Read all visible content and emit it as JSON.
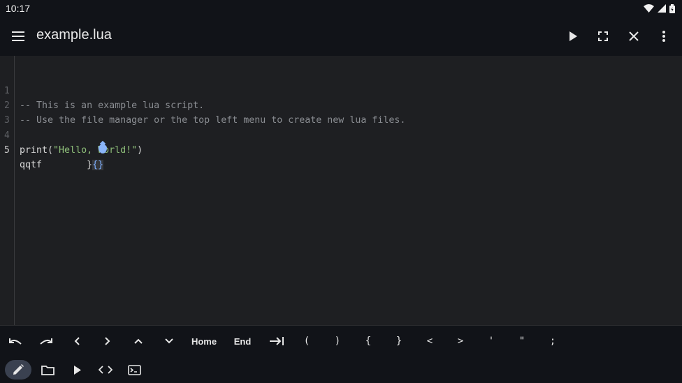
{
  "status": {
    "time": "10:17"
  },
  "appbar": {
    "title": "example.lua"
  },
  "editor": {
    "line_numbers": [
      "1",
      "2",
      "3",
      "4",
      "5"
    ],
    "active_line": "5",
    "lines": [
      {
        "comment": "-- This is an example lua script."
      },
      {
        "comment": "-- Use the file manager or the top left menu to create new lua files."
      },
      {
        "text": ""
      },
      {
        "fn": "print(",
        "str": "\"Hello, World!\"",
        "close": ")"
      },
      {
        "text": "qqtf        }",
        "bracket": "{}"
      }
    ]
  },
  "keybar": {
    "home": "Home",
    "end": "End",
    "open_paren": "(",
    "close_paren": ")",
    "open_brace": "{",
    "close_brace": "}",
    "lt": "<",
    "gt": ">",
    "single_quote": "'",
    "double_quote": "\"",
    "semicolon": ";"
  },
  "colors": {
    "accent": "#8ab4f8",
    "background": "#1e1f22",
    "bar": "#111318",
    "string": "#8fc07a"
  }
}
